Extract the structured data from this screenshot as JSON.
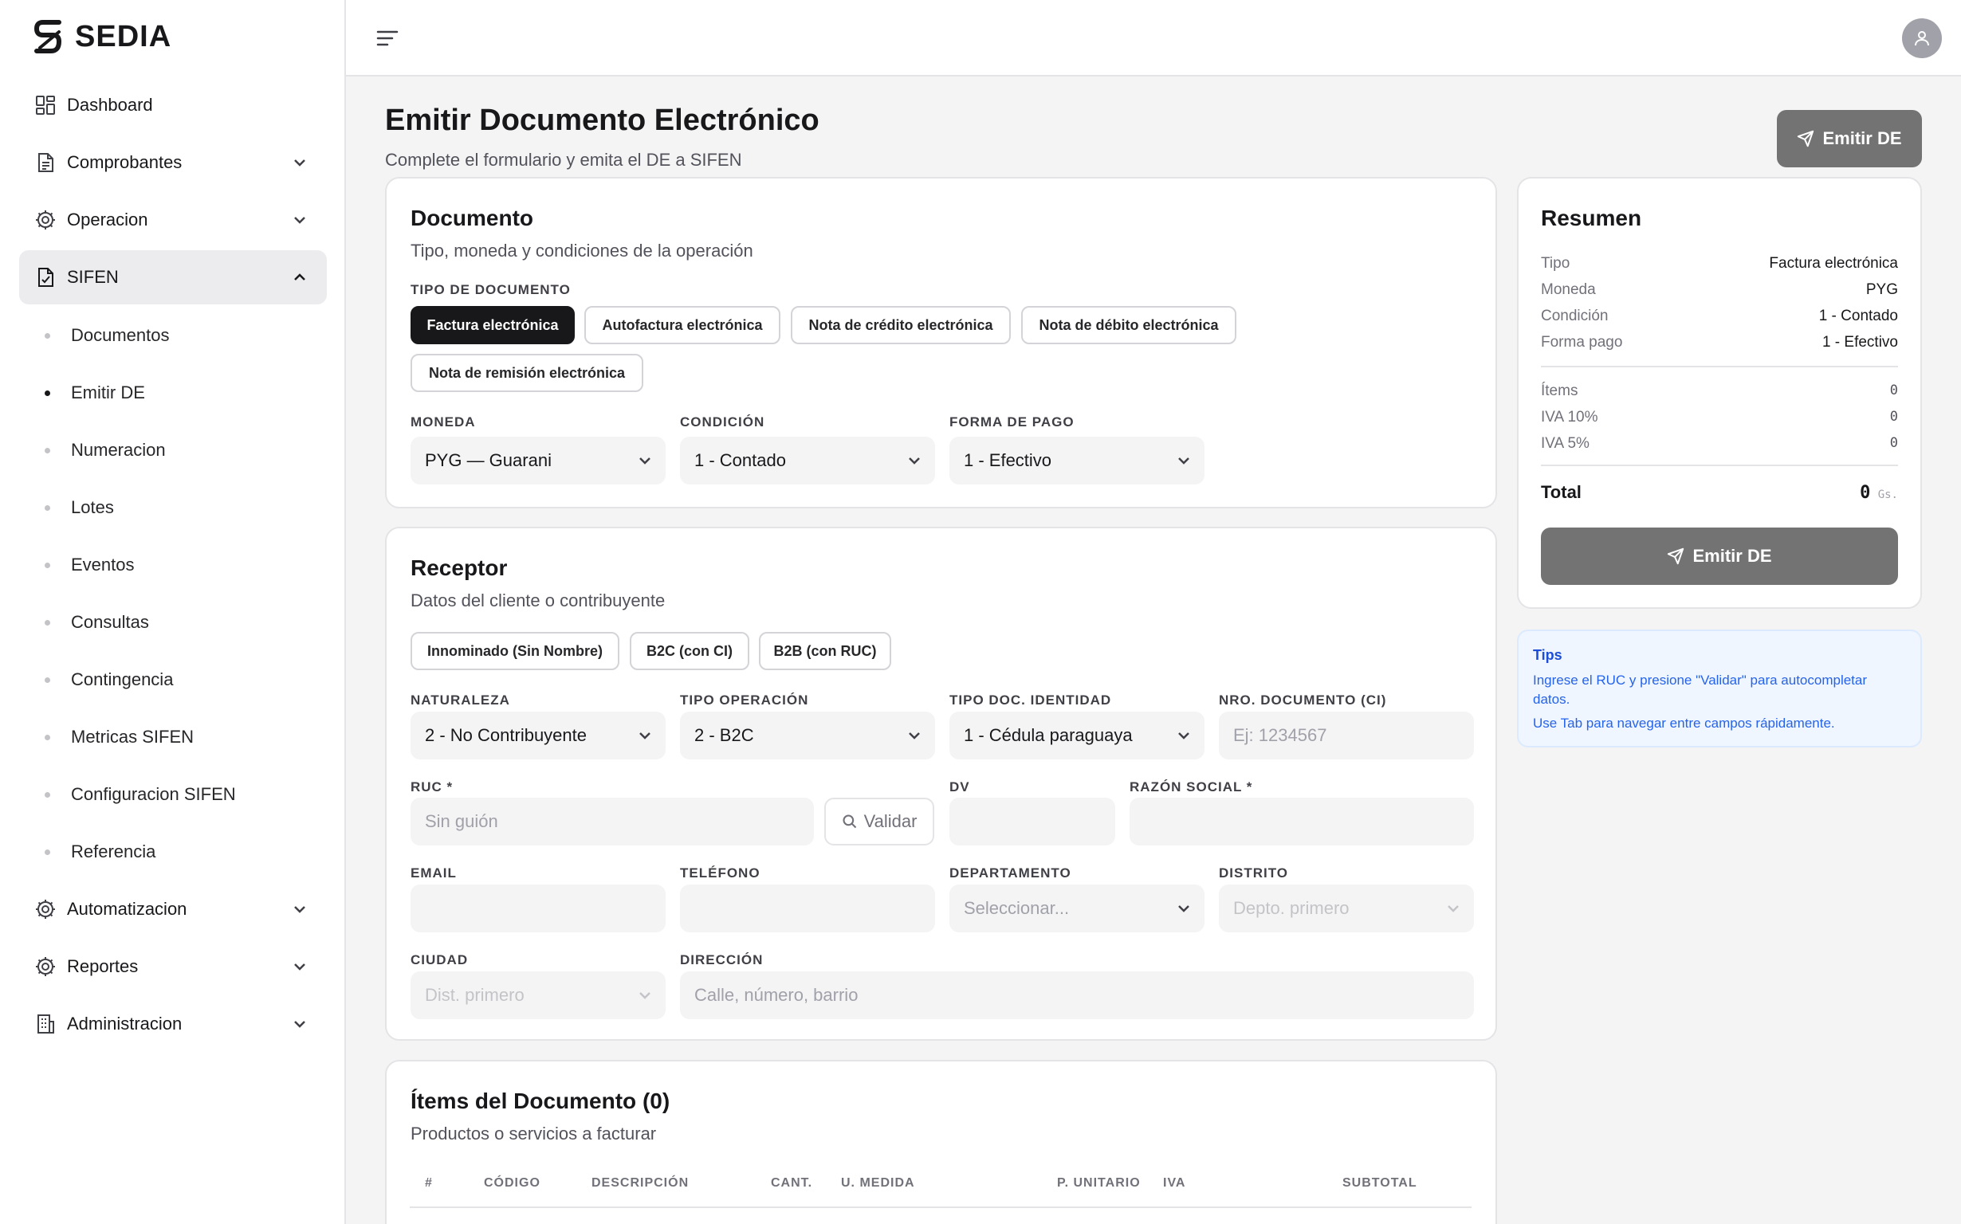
{
  "brand": {
    "name": "SEDIA"
  },
  "sidebar": {
    "items": [
      {
        "label": "Dashboard"
      },
      {
        "label": "Comprobantes"
      },
      {
        "label": "Operacion"
      },
      {
        "label": "SIFEN"
      },
      {
        "label": "Automatizacion"
      },
      {
        "label": "Reportes"
      },
      {
        "label": "Administracion"
      }
    ],
    "sifen_sub": [
      {
        "label": "Documentos"
      },
      {
        "label": "Emitir DE"
      },
      {
        "label": "Numeracion"
      },
      {
        "label": "Lotes"
      },
      {
        "label": "Eventos"
      },
      {
        "label": "Consultas"
      },
      {
        "label": "Contingencia"
      },
      {
        "label": "Metricas SIFEN"
      },
      {
        "label": "Configuracion SIFEN"
      },
      {
        "label": "Referencia"
      }
    ]
  },
  "header": {
    "title": "Emitir Documento Electrónico",
    "subtitle": "Complete el formulario y emita el DE a SIFEN",
    "emit_label": "Emitir DE"
  },
  "documento": {
    "title": "Documento",
    "subtitle": "Tipo, moneda y condiciones de la operación",
    "tipo_label": "TIPO DE DOCUMENTO",
    "tipos": [
      "Factura electrónica",
      "Autofactura electrónica",
      "Nota de crédito electrónica",
      "Nota de débito electrónica",
      "Nota de remisión electrónica"
    ],
    "moneda_label": "MONEDA",
    "moneda_value": "PYG — Guarani",
    "condicion_label": "CONDICIÓN",
    "condicion_value": "1 - Contado",
    "forma_pago_label": "FORMA DE PAGO",
    "forma_pago_value": "1 - Efectivo"
  },
  "receptor": {
    "title": "Receptor",
    "subtitle": "Datos del cliente o contribuyente",
    "tipos": [
      "Innominado (Sin Nombre)",
      "B2C (con CI)",
      "B2B (con RUC)"
    ],
    "naturaleza_label": "NATURALEZA",
    "naturaleza_value": "2 - No Contribuyente",
    "tipo_operacion_label": "TIPO OPERACIÓN",
    "tipo_operacion_value": "2 - B2C",
    "tipo_doc_label": "TIPO DOC. IDENTIDAD",
    "tipo_doc_value": "1 - Cédula paraguaya",
    "nro_doc_label": "NRO. DOCUMENTO (CI)",
    "nro_doc_placeholder": "Ej: 1234567",
    "ruc_label": "RUC *",
    "ruc_placeholder": "Sin guión",
    "validar_label": "Validar",
    "dv_label": "DV",
    "razon_label": "RAZÓN SOCIAL *",
    "email_label": "EMAIL",
    "telefono_label": "TELÉFONO",
    "departamento_label": "DEPARTAMENTO",
    "departamento_placeholder": "Seleccionar...",
    "distrito_label": "DISTRITO",
    "distrito_placeholder": "Depto. primero",
    "ciudad_label": "CIUDAD",
    "ciudad_placeholder": "Dist. primero",
    "direccion_label": "DIRECCIÓN",
    "direccion_placeholder": "Calle, número, barrio"
  },
  "items": {
    "title": "Ítems del Documento (0)",
    "subtitle": "Productos o servicios a facturar",
    "columns": [
      "#",
      "CÓDIGO",
      "DESCRIPCIÓN",
      "CANT.",
      "U. MEDIDA",
      "P. UNITARIO",
      "IVA",
      "SUBTOTAL"
    ]
  },
  "summary": {
    "title": "Resumen",
    "rows": [
      {
        "k": "Tipo",
        "v": "Factura electrónica"
      },
      {
        "k": "Moneda",
        "v": "PYG"
      },
      {
        "k": "Condición",
        "v": "1 - Contado"
      },
      {
        "k": "Forma pago",
        "v": "1 - Efectivo"
      }
    ],
    "items_label": "Ítems",
    "items_value": "0",
    "iva10_label": "IVA 10%",
    "iva10_value": "0",
    "iva5_label": "IVA 5%",
    "iva5_value": "0",
    "total_label": "Total",
    "total_value": "0",
    "total_unit": "Gs.",
    "emit_label": "Emitir DE"
  },
  "tips": {
    "title": "Tips",
    "line1": "Ingrese el RUC y presione \"Validar\" para autocompletar datos.",
    "line2": "Use Tab para navegar entre campos rápidamente."
  },
  "colors": {
    "accent": "#18181b",
    "button_disabled": "#737373",
    "tips_bg": "#eff6ff",
    "tips_text": "#2563eb"
  },
  "icons": [
    "sedia-logo-icon",
    "dashboard-icon",
    "document-icon",
    "gear-icon",
    "file-check-icon",
    "building-icon",
    "menu-icon",
    "user-icon",
    "send-icon",
    "search-icon",
    "chevron-down-icon",
    "chevron-up-icon"
  ]
}
